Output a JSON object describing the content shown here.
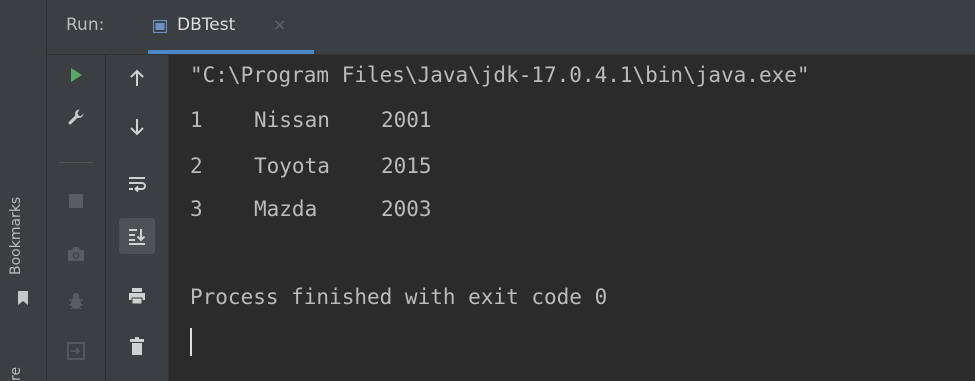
{
  "sidebar": {
    "bookmarks_label": "Bookmarks",
    "bottom_label": "re"
  },
  "header": {
    "run_label": "Run:",
    "tab_title": "DBTest",
    "tab_close": "×"
  },
  "console": {
    "command_line": "\"C:\\Program Files\\Java\\jdk-17.0.4.1\\bin\\java.exe\"",
    "rows": [
      {
        "id": "1",
        "make": "Nissan",
        "year": "2001"
      },
      {
        "id": "2",
        "make": "Toyota",
        "year": "2015"
      },
      {
        "id": "3",
        "make": "Mazda",
        "year": "2003"
      }
    ],
    "exit_message": "Process finished with exit code 0"
  },
  "colors": {
    "background": "#2b2b2b",
    "panel": "#3c3f41",
    "accent": "#4a88c7",
    "run_green": "#59a869",
    "text": "#bbbbbb"
  },
  "icons": {
    "toolbar_a": [
      "run-icon",
      "wrench-icon",
      "stop-icon",
      "camera-icon",
      "debug-icon",
      "restore-layout-icon"
    ],
    "toolbar_b": [
      "arrow-up-icon",
      "arrow-down-icon",
      "soft-wrap-icon",
      "scroll-to-end-icon",
      "print-icon",
      "trash-icon"
    ]
  }
}
